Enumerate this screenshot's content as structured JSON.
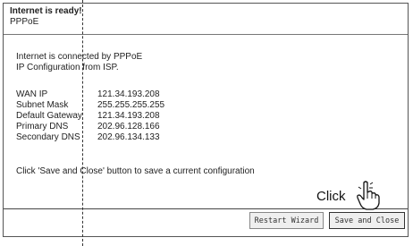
{
  "header": {
    "title": "Internet is ready!",
    "subtitle": "PPPoE"
  },
  "description": {
    "line1": "Internet is connected by PPPoE",
    "line2": "IP Configuration from ISP."
  },
  "info": [
    {
      "label": "WAN IP",
      "value": "121.34.193.208"
    },
    {
      "label": "Subnet Mask",
      "value": "255.255.255.255"
    },
    {
      "label": "Default Gateway",
      "value": "121.34.193.208"
    },
    {
      "label": "Primary DNS",
      "value": "202.96.128.166"
    },
    {
      "label": "Secondary DNS",
      "value": "202.96.134.133"
    }
  ],
  "note": "Click 'Save and Close' button to save a current configuration",
  "buttons": {
    "restart": "Restart Wizard",
    "save_close": "Save and Close"
  },
  "callout": {
    "text": "Click",
    "icon": "pointing-hand-icon"
  }
}
